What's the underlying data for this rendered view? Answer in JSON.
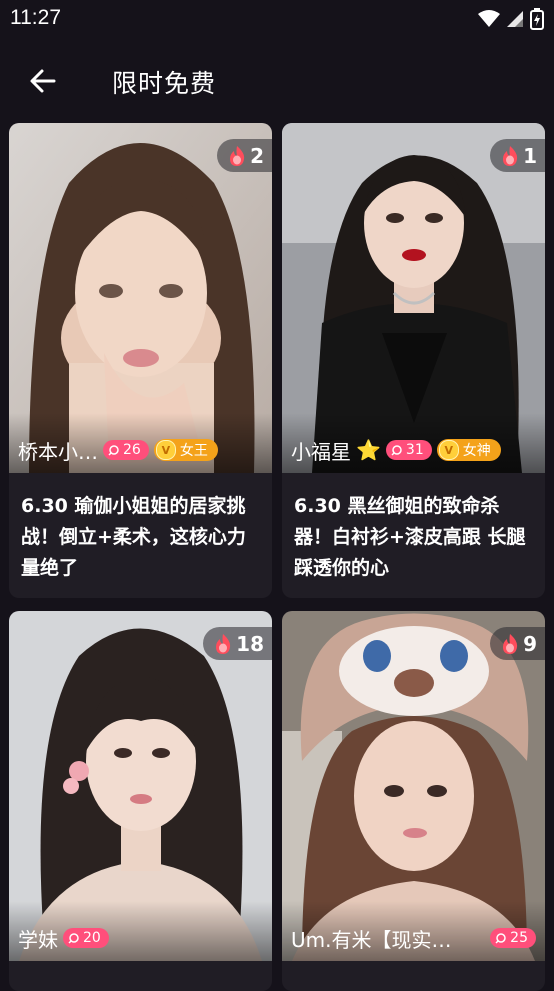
{
  "status_bar": {
    "time": "11:27"
  },
  "header": {
    "title": "限时免费"
  },
  "cards": [
    {
      "hot_count": "2",
      "author": "桥本小…",
      "level": "26",
      "vip_label": "女王",
      "title": "6.30 瑜伽小姐姐的居家挑战！倒立+柔术，这核心力量绝了"
    },
    {
      "hot_count": "1",
      "author": "小福星",
      "author_emoji": "⭐",
      "level": "31",
      "vip_label": "女神",
      "title": "6.30 黑丝御姐的致命杀器！白衬衫+漆皮高跟 长腿踩透你的心"
    },
    {
      "hot_count": "18",
      "author": "学妹",
      "level": "20",
      "title": ""
    },
    {
      "hot_count": "9",
      "author": "Um.有米【现实…",
      "level": "25",
      "title": ""
    }
  ],
  "colors": {
    "background": "#15121a",
    "card": "#201d25",
    "level_pill": "#ff4f7b",
    "vip_pill": "#f4a21a"
  },
  "icons": [
    "back-arrow-icon",
    "wifi-icon",
    "signal-icon",
    "battery-icon",
    "flame-icon",
    "heart-level-icon",
    "vip-crown-icon",
    "star-icon"
  ]
}
